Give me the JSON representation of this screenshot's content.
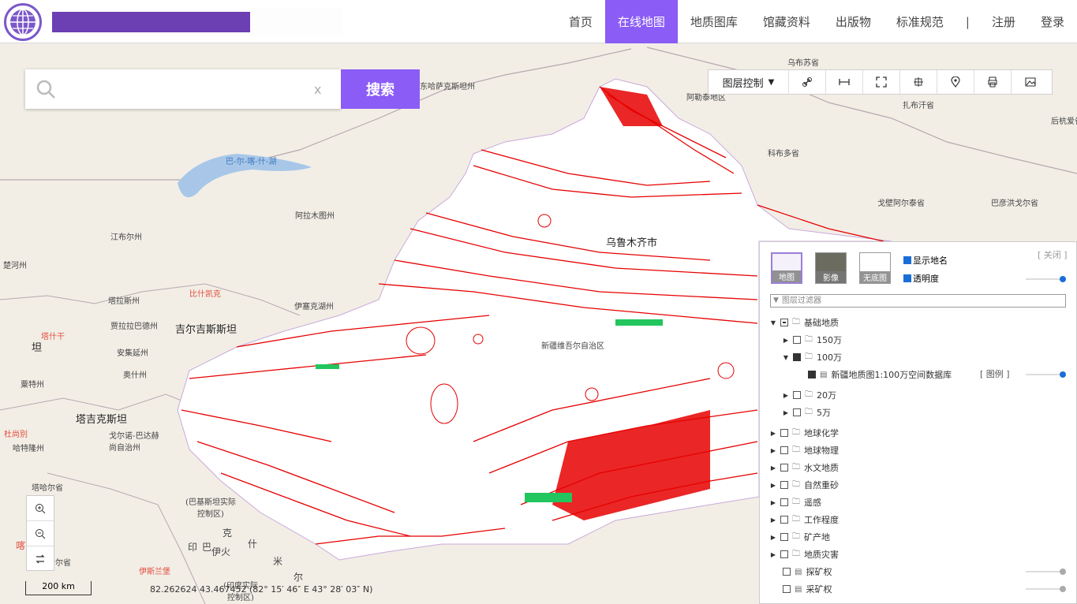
{
  "header": {
    "nav": [
      {
        "label": "首页"
      },
      {
        "label": "在线地图"
      },
      {
        "label": "地质图库"
      },
      {
        "label": "馆藏资料"
      },
      {
        "label": "出版物"
      },
      {
        "label": "标准规范"
      }
    ],
    "separator": "|",
    "register": "注册",
    "login": "登录",
    "active_color": "#8b5cf6",
    "brand_bar_color": "#6c3fb3"
  },
  "search": {
    "value": "",
    "clear": "x",
    "button": "搜索"
  },
  "toolbar": {
    "layer_control": "图层控制"
  },
  "panel": {
    "close": "[ 关闭 ]",
    "basemaps": [
      "地图",
      "影像",
      "无底图"
    ],
    "show_names": "显示地名",
    "transparency": "透明度",
    "filter_placeholder": "图层过滤器",
    "tree": {
      "root": "基础地质",
      "s150": "150万",
      "s100": "100万",
      "dataset": "新疆地质图1:100万空间数据库",
      "legend": "[ 图例 ]",
      "s20": "20万",
      "s5": "5万",
      "others": [
        "地球化学",
        "地球物理",
        "水文地质",
        "自然重砂",
        "遥感",
        "工作程度",
        "矿产地",
        "地质灾害"
      ],
      "explore": "探矿权",
      "mining": "采矿权"
    }
  },
  "map": {
    "places": [
      "乌布苏省",
      "东哈萨克斯坦州",
      "阿勒泰地区",
      "扎布汗省",
      "后杭爱省",
      "巴-尔-喀-什-湖",
      "科布多省",
      "阿拉木图州",
      "戈壁阿尔泰省",
      "巴彦洪戈尔省",
      "江布尔州",
      "乌鲁木齐市",
      "楚河州",
      "比什凯克",
      "塔拉斯州",
      "伊塞克湖州",
      "贾拉拉巴德州",
      "吉尔吉斯斯坦",
      "安集延州",
      "塔什干",
      "坦",
      "新疆维吾尔自治区",
      "奥什州",
      "粟特州",
      "塔吉克斯坦",
      "戈尔诺-巴达赫尚自治州",
      "杜尚别",
      "哈特隆州",
      "塔哈尔省",
      "(巴基斯坦实际控制区)",
      "克",
      "什",
      "印",
      "巴",
      "伊",
      "火",
      "米",
      "尔",
      "喀",
      "楠格哈尔省",
      "伊斯兰堡",
      "(印度实际控制区)"
    ],
    "scale": "200 km",
    "coords": "82.262624 43.467452 (82° 15′ 46″ E 43° 28′ 03″ N)"
  }
}
